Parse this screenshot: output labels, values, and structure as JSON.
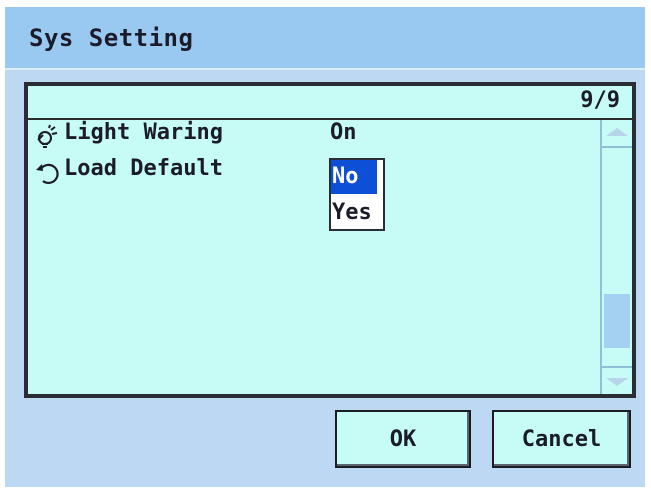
{
  "dialog": {
    "title": "Sys Setting",
    "page_indicator": "9/9"
  },
  "settings": [
    {
      "label": "Light Waring",
      "value": "On",
      "icon": "light-icon"
    },
    {
      "label": "Load Default",
      "value": "No",
      "icon": "undo-icon"
    }
  ],
  "dropdown": {
    "options": [
      "No",
      "Yes"
    ],
    "selected": "No"
  },
  "buttons": {
    "ok_label": "OK",
    "cancel_label": "Cancel"
  },
  "colors": {
    "title_bar": "#99c9f0",
    "background": "#bcd8f2",
    "panel": "#c7fbf6",
    "selection": "#0d4fd6"
  },
  "scrollbar": {
    "position": "bottom"
  }
}
